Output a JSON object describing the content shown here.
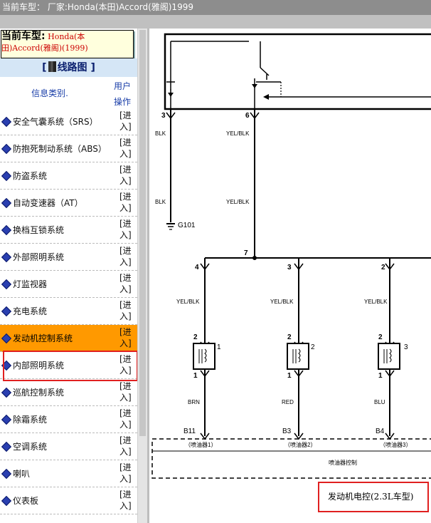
{
  "window": {
    "title_prefix": "当前车型：",
    "title_maker": "厂家:Honda(本田)Accord(雅阁)1999"
  },
  "sidebar": {
    "car_label": "当前车型:",
    "car_value": "Honda(本田)Accord(雅阁)(1999)",
    "header_text": "线路图",
    "header_open": "[",
    "header_close": "]",
    "col_info": "信息类别.",
    "col_op_1": "用户",
    "col_op_2": "操作",
    "enter_label_1": "[进",
    "enter_label_2": "入]",
    "items": [
      {
        "label": "安全气囊系统（SRS）"
      },
      {
        "label": "防抱死制动系统（ABS）"
      },
      {
        "label": "防盗系统"
      },
      {
        "label": "自动变速器（AT）"
      },
      {
        "label": "换档互锁系统"
      },
      {
        "label": "外部照明系统"
      },
      {
        "label": "灯监视器"
      },
      {
        "label": "充电系统"
      },
      {
        "label": "发动机控制系统",
        "active": true
      },
      {
        "label": "内部照明系统"
      },
      {
        "label": "巡航控制系统"
      },
      {
        "label": "除霜系统"
      },
      {
        "label": "空调系统"
      },
      {
        "label": "喇叭"
      },
      {
        "label": "仪表板"
      }
    ]
  },
  "diagram": {
    "pins_top": [
      "3",
      "6"
    ],
    "wire_blk": "BLK",
    "wire_yelblk": "YEL/BLK",
    "ground": "G101",
    "junction": "7",
    "branch_pins": [
      "4",
      "3",
      "2"
    ],
    "injector_pin_top": "2",
    "injector_pin_bottom": "1",
    "injector_side_pins": [
      "1",
      "2",
      "3"
    ],
    "wires_bottom": [
      "BRN",
      "RED",
      "BLU"
    ],
    "ecm_pins": [
      "B11",
      "B3",
      "B4"
    ],
    "injector_names": [
      "（喷油器1）",
      "（喷油器2）",
      "（喷油器3）"
    ],
    "ecm_label": "喷油器控制",
    "caption": "发动机电控(2.3L车型)"
  },
  "colors": {
    "active_row": "#ff9900",
    "highlight_border": "#e02020",
    "car_value": "#cc0000",
    "header_bg": "#d5e6f6"
  }
}
